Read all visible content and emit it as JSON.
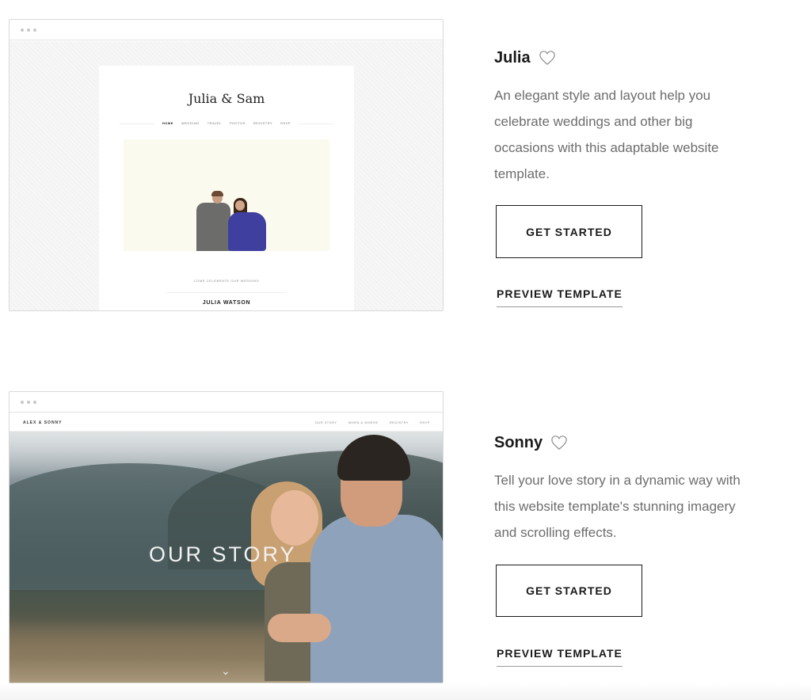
{
  "templates": [
    {
      "name": "Julia",
      "description": "An elegant style and layout help you celebrate weddings and other big occasions with this adaptable website template.",
      "get_started_label": "GET STARTED",
      "preview_label": "PREVIEW TEMPLATE",
      "heart_icon": "heart-outline-icon",
      "preview": {
        "site_title": "Julia & Sam",
        "nav": [
          "HOME",
          "WEDDING",
          "TRAVEL",
          "PHOTOS",
          "REGISTRY",
          "RSVP"
        ],
        "active_nav": "HOME",
        "tagline": "COME CELEBRATE OUR WEDDING",
        "footer_name": "JULIA WATSON"
      }
    },
    {
      "name": "Sonny",
      "description": "Tell your love story in a dynamic way with this website template's stunning imagery and scrolling effects.",
      "get_started_label": "GET STARTED",
      "preview_label": "PREVIEW TEMPLATE",
      "heart_icon": "heart-outline-icon",
      "preview": {
        "logo": "ALEX & SONNY",
        "nav": [
          "OUR STORY",
          "WHEN & WHERE",
          "REGISTRY",
          "RSVP"
        ],
        "hero_title": "OUR STORY",
        "scroll_icon": "chevron-down-icon"
      }
    }
  ],
  "colors": {
    "text": "#1a1a1a",
    "description": "#6d6d6d",
    "button_border": "#1a1a1a",
    "julia_accent": "#3f3fa0"
  }
}
